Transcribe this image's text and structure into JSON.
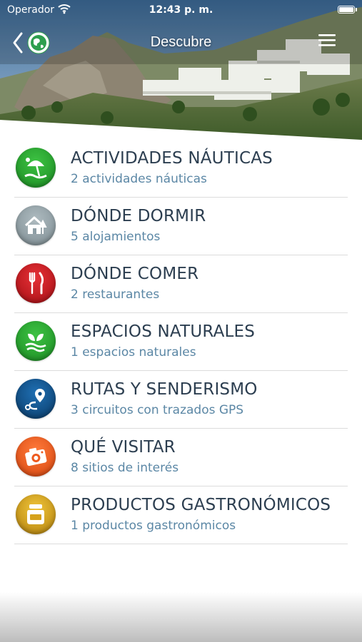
{
  "status_bar": {
    "carrier": "Operador",
    "time": "12:43 p. m."
  },
  "nav": {
    "title": "Descubre"
  },
  "colors": {
    "title_text": "#2c3e50",
    "subtitle_text": "#5b87a5",
    "divider": "#dcdcdc"
  },
  "categories": [
    {
      "title": "ACTIVIDADES NÁUTICAS",
      "subtitle": "2 actividades náuticas",
      "icon": "beach-umbrella-icon",
      "color": "#25a32c"
    },
    {
      "title": "DÓNDE DORMIR",
      "subtitle": "5 alojamientos",
      "icon": "house-icon",
      "color": "#8e9ea5"
    },
    {
      "title": "DÓNDE COMER",
      "subtitle": "2 restaurantes",
      "icon": "fork-knife-icon",
      "color": "#c8161b"
    },
    {
      "title": "ESPACIOS NATURALES",
      "subtitle": "1 espacios naturales",
      "icon": "leaf-icon",
      "color": "#25a32c"
    },
    {
      "title": "RUTAS Y SENDERISMO",
      "subtitle": "3 circuitos con trazados GPS",
      "icon": "route-pin-icon",
      "color": "#0e4f8a"
    },
    {
      "title": "QUÉ VISITAR",
      "subtitle": "8 sitios de interés",
      "icon": "camera-icon",
      "color": "#ee5a1e"
    },
    {
      "title": "PRODUCTOS GASTRONÓMICOS",
      "subtitle": "1 productos gastronómicos",
      "icon": "jar-icon",
      "color": "#d6a21a"
    }
  ]
}
